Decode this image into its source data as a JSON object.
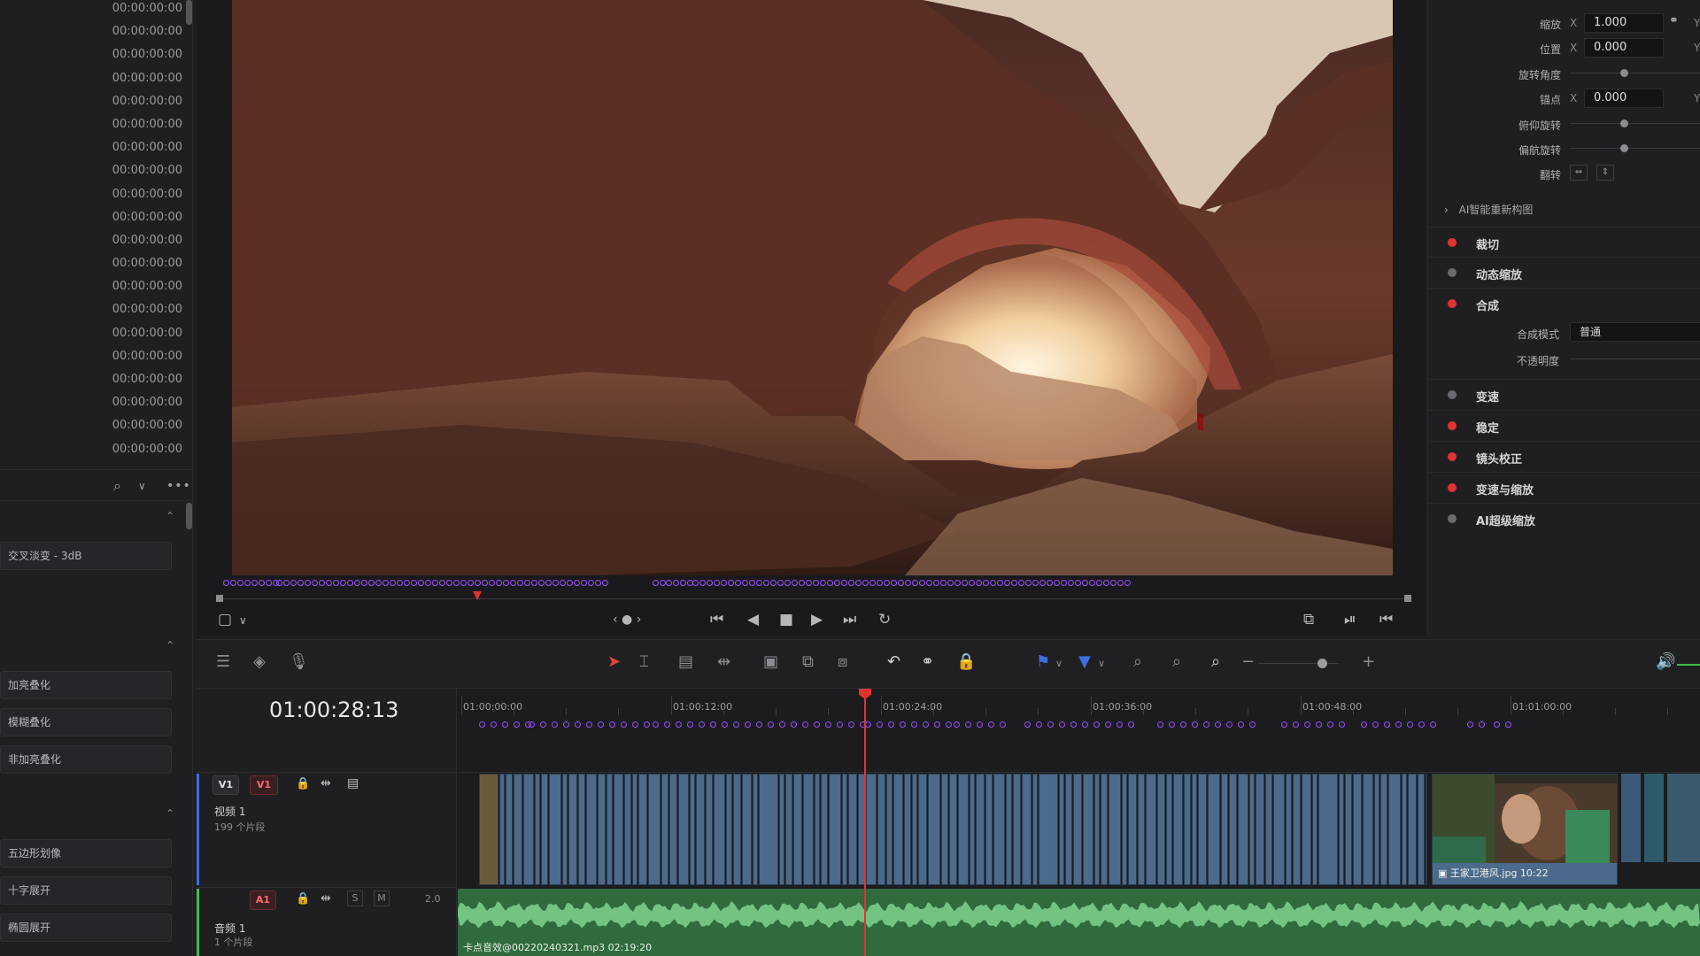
{
  "timecode_list": [
    "00:00:00:00",
    "00:00:00:00",
    "00:00:00:00",
    "00:00:00:00",
    "00:00:00:00",
    "00:00:00:00",
    "00:00:00:00",
    "00:00:00:00",
    "00:00:00:00",
    "00:00:00:00",
    "00:00:00:00",
    "00:00:00:00",
    "00:00:00:00",
    "00:00:00:00",
    "00:00:00:00",
    "00:00:00:00",
    "00:00:00:00",
    "00:00:00:00",
    "00:00:00:00",
    "00:00:00:00"
  ],
  "left_effects": {
    "audio_transition": "交叉淡变 - 3dB",
    "blend": [
      "加亮叠化",
      "模糊叠化",
      "非加亮叠化"
    ],
    "shape": [
      "五边形划像",
      "十字展开",
      "椭圆展开"
    ]
  },
  "inspector": {
    "zoom_label": "缩放",
    "zoom_x": "1.000",
    "position_label": "位置",
    "position_x": "0.000",
    "rotation_label": "旋转角度",
    "rotation_level": 0.38,
    "anchor_label": "锚点",
    "anchor_x": "0.000",
    "pitch_label": "俯仰旋转",
    "pitch_level": 0.38,
    "yaw_label": "偏航旋转",
    "yaw_level": 0.38,
    "flip_label": "翻转",
    "x_char": "X",
    "y_char": "Y",
    "ai_reframe": "AI智能重新构图",
    "sections": [
      {
        "label": "裁切",
        "active": true
      },
      {
        "label": "动态缩放",
        "active": false
      },
      {
        "label": "合成",
        "active": true
      },
      {
        "label": "变速",
        "active": false
      },
      {
        "label": "稳定",
        "active": true
      },
      {
        "label": "镜头校正",
        "active": true
      },
      {
        "label": "变速与缩放",
        "active": true
      },
      {
        "label": "AI超级缩放",
        "active": false
      }
    ],
    "composite_mode_label": "合成模式",
    "composite_mode_value": "普通",
    "opacity_label": "不透明度"
  },
  "timeline": {
    "current_tc": "01:00:28:13",
    "ruler_labels": [
      "01:00:00:00",
      "01:00:12:00",
      "01:00:24:00",
      "01:00:36:00",
      "01:00:48:00",
      "01:01:00:00"
    ],
    "video_track": {
      "badge_src": "V1",
      "badge_dst": "V1",
      "name": "视频 1",
      "count": "199 个片段"
    },
    "audio_track": {
      "badge": "A1",
      "solo": "S",
      "mute": "M",
      "level": "2.0",
      "name": "音频 1",
      "count": "1 个片段"
    },
    "still_clip": "王家卫港风.jpg  10:22",
    "audio_clip": "卡点音效@00220240321.mp3  02:19:20"
  },
  "colors": {
    "accent_red": "#e23333",
    "marker_purple": "#9a4dff",
    "video_clip": "#4c6b8c",
    "audio_clip": "#2f6b3c"
  }
}
